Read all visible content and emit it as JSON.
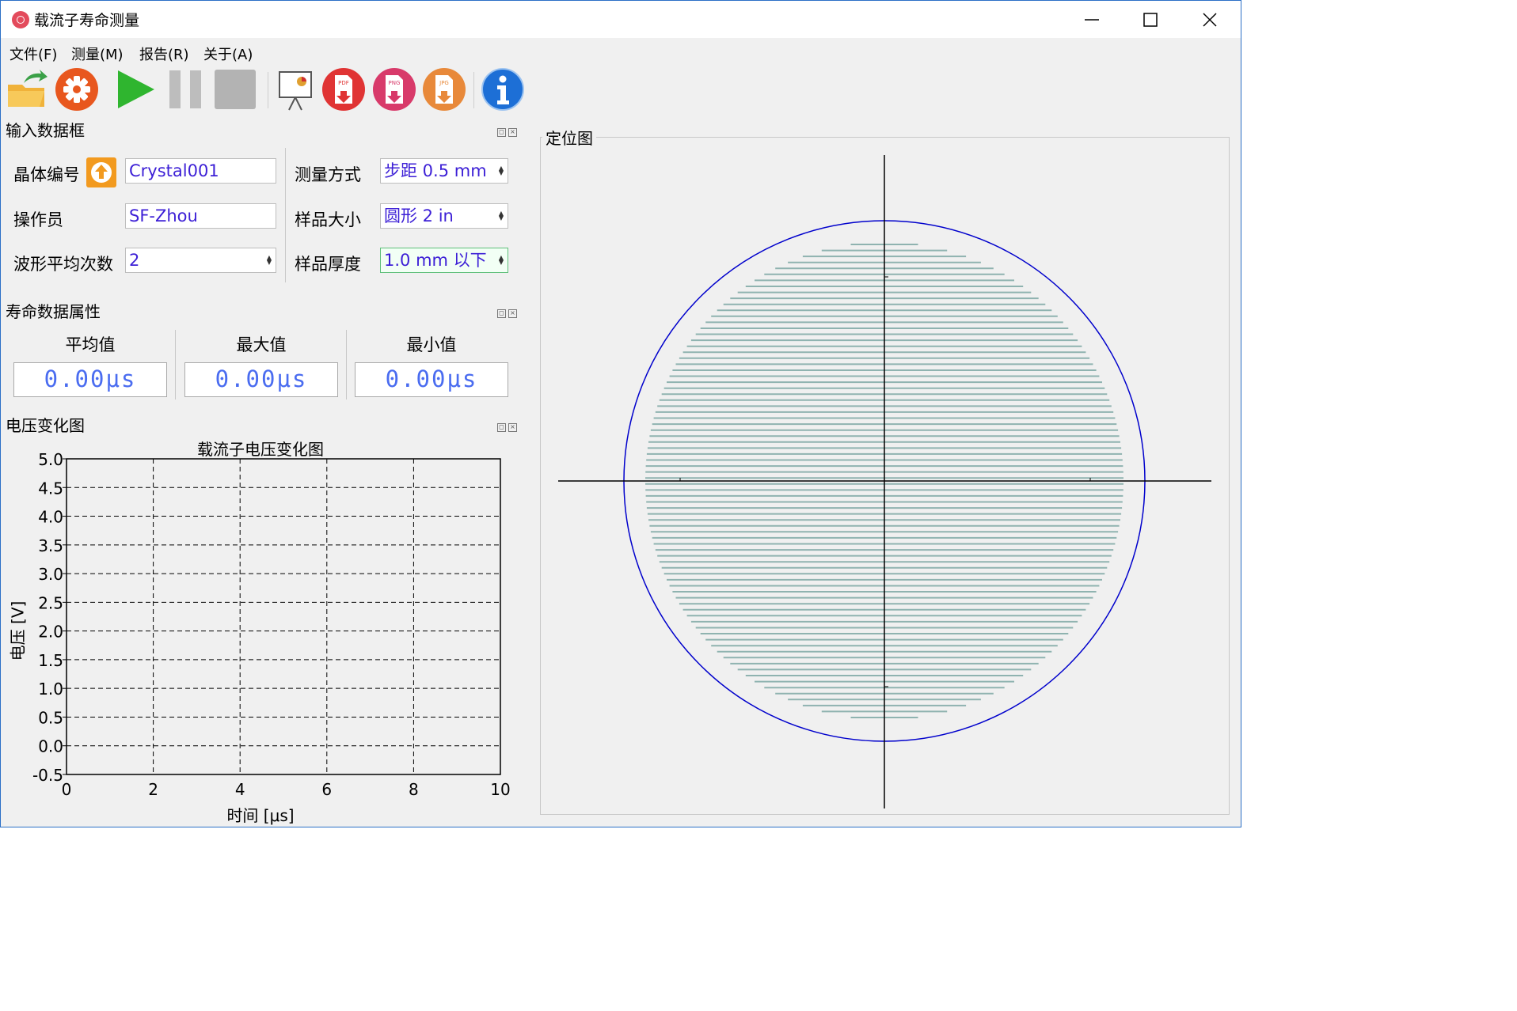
{
  "window": {
    "title": "载流子寿命测量",
    "controls": [
      "minimize",
      "maximize",
      "close"
    ]
  },
  "menu": [
    "文件(F)",
    "测量(M)",
    "报告(R)",
    "关于(A)"
  ],
  "toolbar": [
    {
      "name": "open-folder-icon"
    },
    {
      "name": "settings-gear-icon"
    },
    {
      "name": "play-icon"
    },
    {
      "name": "pause-icon"
    },
    {
      "name": "stop-icon"
    },
    {
      "name": "presentation-report-icon"
    },
    {
      "name": "export-pdf-icon",
      "badge": "PDF"
    },
    {
      "name": "export-png-icon",
      "badge": "PNG"
    },
    {
      "name": "export-jpg-icon",
      "badge": "JPG"
    },
    {
      "name": "info-icon"
    }
  ],
  "colors": {
    "input_text": "#3c1fd6",
    "stat_text": "#4a6cf0",
    "circle": "#0000cc",
    "scan_lines": "#8fb3b0"
  },
  "input_panel": {
    "title": "输入数据框",
    "crystal_label": "晶体编号",
    "crystal_value": "Crystal001",
    "operator_label": "操作员",
    "operator_value": "SF-Zhou",
    "avg_label": "波形平均次数",
    "avg_value": "2",
    "method_label": "测量方式",
    "method_value": "步距 0.5 mm",
    "size_label": "样品大小",
    "size_value": "圆形 2 in",
    "thickness_label": "样品厚度",
    "thickness_value": "1.0 mm 以下"
  },
  "stats_panel": {
    "title": "寿命数据属性",
    "avg_label": "平均值",
    "avg_value": "0.00μs",
    "max_label": "最大值",
    "max_value": "0.00μs",
    "min_label": "最小值",
    "min_value": "0.00μs"
  },
  "voltage_panel": {
    "title": "电压变化图"
  },
  "chart_data": {
    "type": "line",
    "title": "载流子电压变化图",
    "xlabel": "时间 [μs]",
    "ylabel": "电压 [V]",
    "xlim": [
      0,
      10
    ],
    "ylim": [
      -0.5,
      5.0
    ],
    "xticks": [
      "0",
      "2",
      "4",
      "6",
      "8",
      "10"
    ],
    "yticks": [
      "5.0",
      "4.5",
      "4.0",
      "3.5",
      "3.0",
      "2.5",
      "2.0",
      "1.5",
      "1.0",
      "0.5",
      "0.0",
      "-0.5"
    ],
    "grid": "dashed",
    "series": []
  },
  "position_map": {
    "title": "定位图",
    "shape": "circle",
    "scan_line_count": 80
  }
}
